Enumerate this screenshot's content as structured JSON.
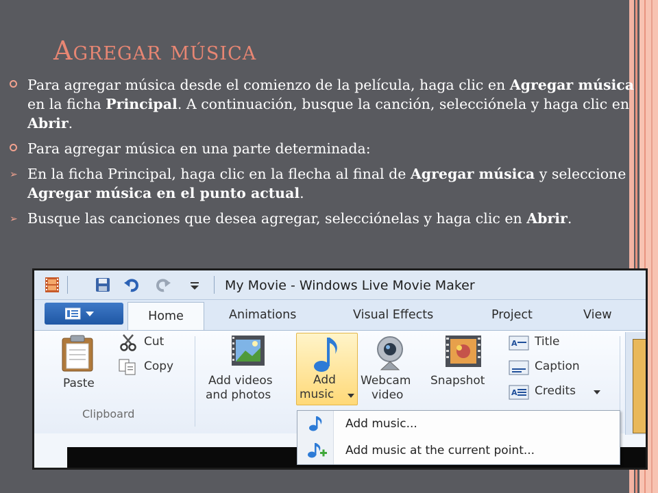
{
  "slide": {
    "title": "Agregar música",
    "bullets": [
      {
        "marker": "circle",
        "parts": [
          {
            "t": "Para agregar música desde el comienzo de la película, haga clic en ",
            "b": false
          },
          {
            "t": "Agregar música",
            "b": true
          },
          {
            "t": " en la ficha ",
            "b": false
          },
          {
            "t": "Principal",
            "b": true
          },
          {
            "t": ". A continuación, busque la canción, selecciónela y haga clic en ",
            "b": false
          },
          {
            "t": "Abrir",
            "b": true
          },
          {
            "t": ".",
            "b": false
          }
        ]
      },
      {
        "marker": "circle",
        "parts": [
          {
            "t": "Para agregar música en una parte determinada:",
            "b": false
          }
        ]
      },
      {
        "marker": "arrow",
        "parts": [
          {
            "t": "En la ficha Principal, haga clic en la flecha al final de ",
            "b": false
          },
          {
            "t": "Agregar música",
            "b": true
          },
          {
            "t": " y seleccione ",
            "b": false
          },
          {
            "t": "Agregar música en el punto actual",
            "b": true
          },
          {
            "t": ".",
            "b": false
          }
        ]
      },
      {
        "marker": "arrow",
        "parts": [
          {
            "t": "Busque las canciones que desea agregar, selecciónelas y haga clic en ",
            "b": false
          },
          {
            "t": "Abrir",
            "b": true
          },
          {
            "t": ".",
            "b": false
          }
        ]
      }
    ]
  },
  "colors": {
    "background": "#595a5f",
    "title": "#e88673",
    "bullet_marker": "#f2a28f",
    "rail_light": "#f8c4b4",
    "rail_dark": "#e8937f",
    "file_button": "#2a63b3"
  },
  "window": {
    "title": "My Movie - Windows Live Movie Maker",
    "quick_access": [
      "film-icon",
      "save-icon",
      "undo-icon",
      "redo-icon",
      "customize-dropdown-icon"
    ]
  },
  "tabs": [
    {
      "label": "Home",
      "active": true
    },
    {
      "label": "Animations",
      "active": false
    },
    {
      "label": "Visual Effects",
      "active": false
    },
    {
      "label": "Project",
      "active": false
    },
    {
      "label": "View",
      "active": false
    }
  ],
  "ribbon": {
    "clipboard": {
      "group_label": "Clipboard",
      "paste": "Paste",
      "cut": "Cut",
      "copy": "Copy"
    },
    "add": {
      "add_videos_line1": "Add videos",
      "add_videos_line2": "and photos",
      "add_music_line1": "Add",
      "add_music_line2": "music",
      "webcam_line1": "Webcam",
      "webcam_line2": "video",
      "snapshot": "Snapshot"
    },
    "text": {
      "title": "Title",
      "caption": "Caption",
      "credits": "Credits"
    }
  },
  "dropdown": {
    "items": [
      {
        "label": "Add music...",
        "icon": "music-note-icon"
      },
      {
        "label": "Add music at the current point...",
        "icon": "music-note-plus-icon"
      }
    ]
  }
}
